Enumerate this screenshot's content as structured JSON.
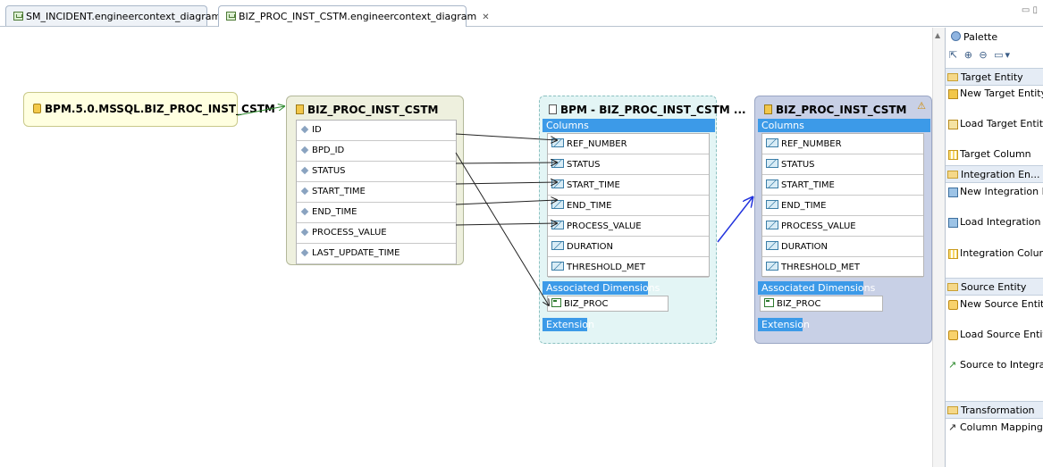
{
  "tabs": [
    {
      "label": "SM_INCIDENT.engineercontext_diagram",
      "active": false
    },
    {
      "label": "BIZ_PROC_INST_CSTM.engineercontext_diagram",
      "active": true
    }
  ],
  "tab_close_glyph": "✕",
  "window_controls": "▭ ▯",
  "nodes": {
    "source_db": {
      "title": "BPM.5.0.MSSQL.BIZ_PROC_INST_CSTM"
    },
    "source_entity": {
      "title": "BIZ_PROC_INST_CSTM",
      "rows": [
        "ID",
        "BPD_ID",
        "STATUS",
        "START_TIME",
        "END_TIME",
        "PROCESS_VALUE",
        "LAST_UPDATE_TIME"
      ]
    },
    "integration_entity": {
      "title": "BPM - BIZ_PROC_INST_CSTM ...",
      "columns_label": "Columns",
      "columns": [
        "REF_NUMBER",
        "STATUS",
        "START_TIME",
        "END_TIME",
        "PROCESS_VALUE",
        "DURATION",
        "THRESHOLD_MET"
      ],
      "dimensions_label": "Associated Dimensions",
      "dimensions": [
        "BIZ_PROC"
      ],
      "extension_label": "Extension"
    },
    "target_entity": {
      "title": "BIZ_PROC_INST_CSTM",
      "columns_label": "Columns",
      "columns": [
        "REF_NUMBER",
        "STATUS",
        "START_TIME",
        "END_TIME",
        "PROCESS_VALUE",
        "DURATION",
        "THRESHOLD_MET"
      ],
      "dimensions_label": "Associated Dimensions",
      "dimensions": [
        "BIZ_PROC"
      ],
      "extension_label": "Extension",
      "warning_glyph": "⚠"
    }
  },
  "palette": {
    "title": "Palette",
    "tools": "⇱ ⊕ ⊖ ▭▾",
    "drawers": [
      {
        "label": "Target Entity",
        "items": [
          "New Target Entity",
          "Load Target Entity",
          "Target Column"
        ]
      },
      {
        "label": "Integration En...",
        "items": [
          "New Integration Entity",
          "Load Integration Entity",
          "Integration Column"
        ]
      },
      {
        "label": "Source Entity",
        "items": [
          "New Source Entity",
          "Load Source Entity",
          "Source to Integration Relation"
        ]
      },
      {
        "label": "Transformation",
        "items": [
          "Column Mapping"
        ]
      }
    ]
  },
  "colors": {
    "source_db_fill": "#ffffe0",
    "source_entity_fill": "#eef0de",
    "integration_fill": "#e3f5f5",
    "target_fill": "#c8d0e6",
    "section_header": "#3c9ae8",
    "edge_green": "#2e8b2e",
    "edge_blue": "#2233dd",
    "edge_black": "#222222"
  }
}
